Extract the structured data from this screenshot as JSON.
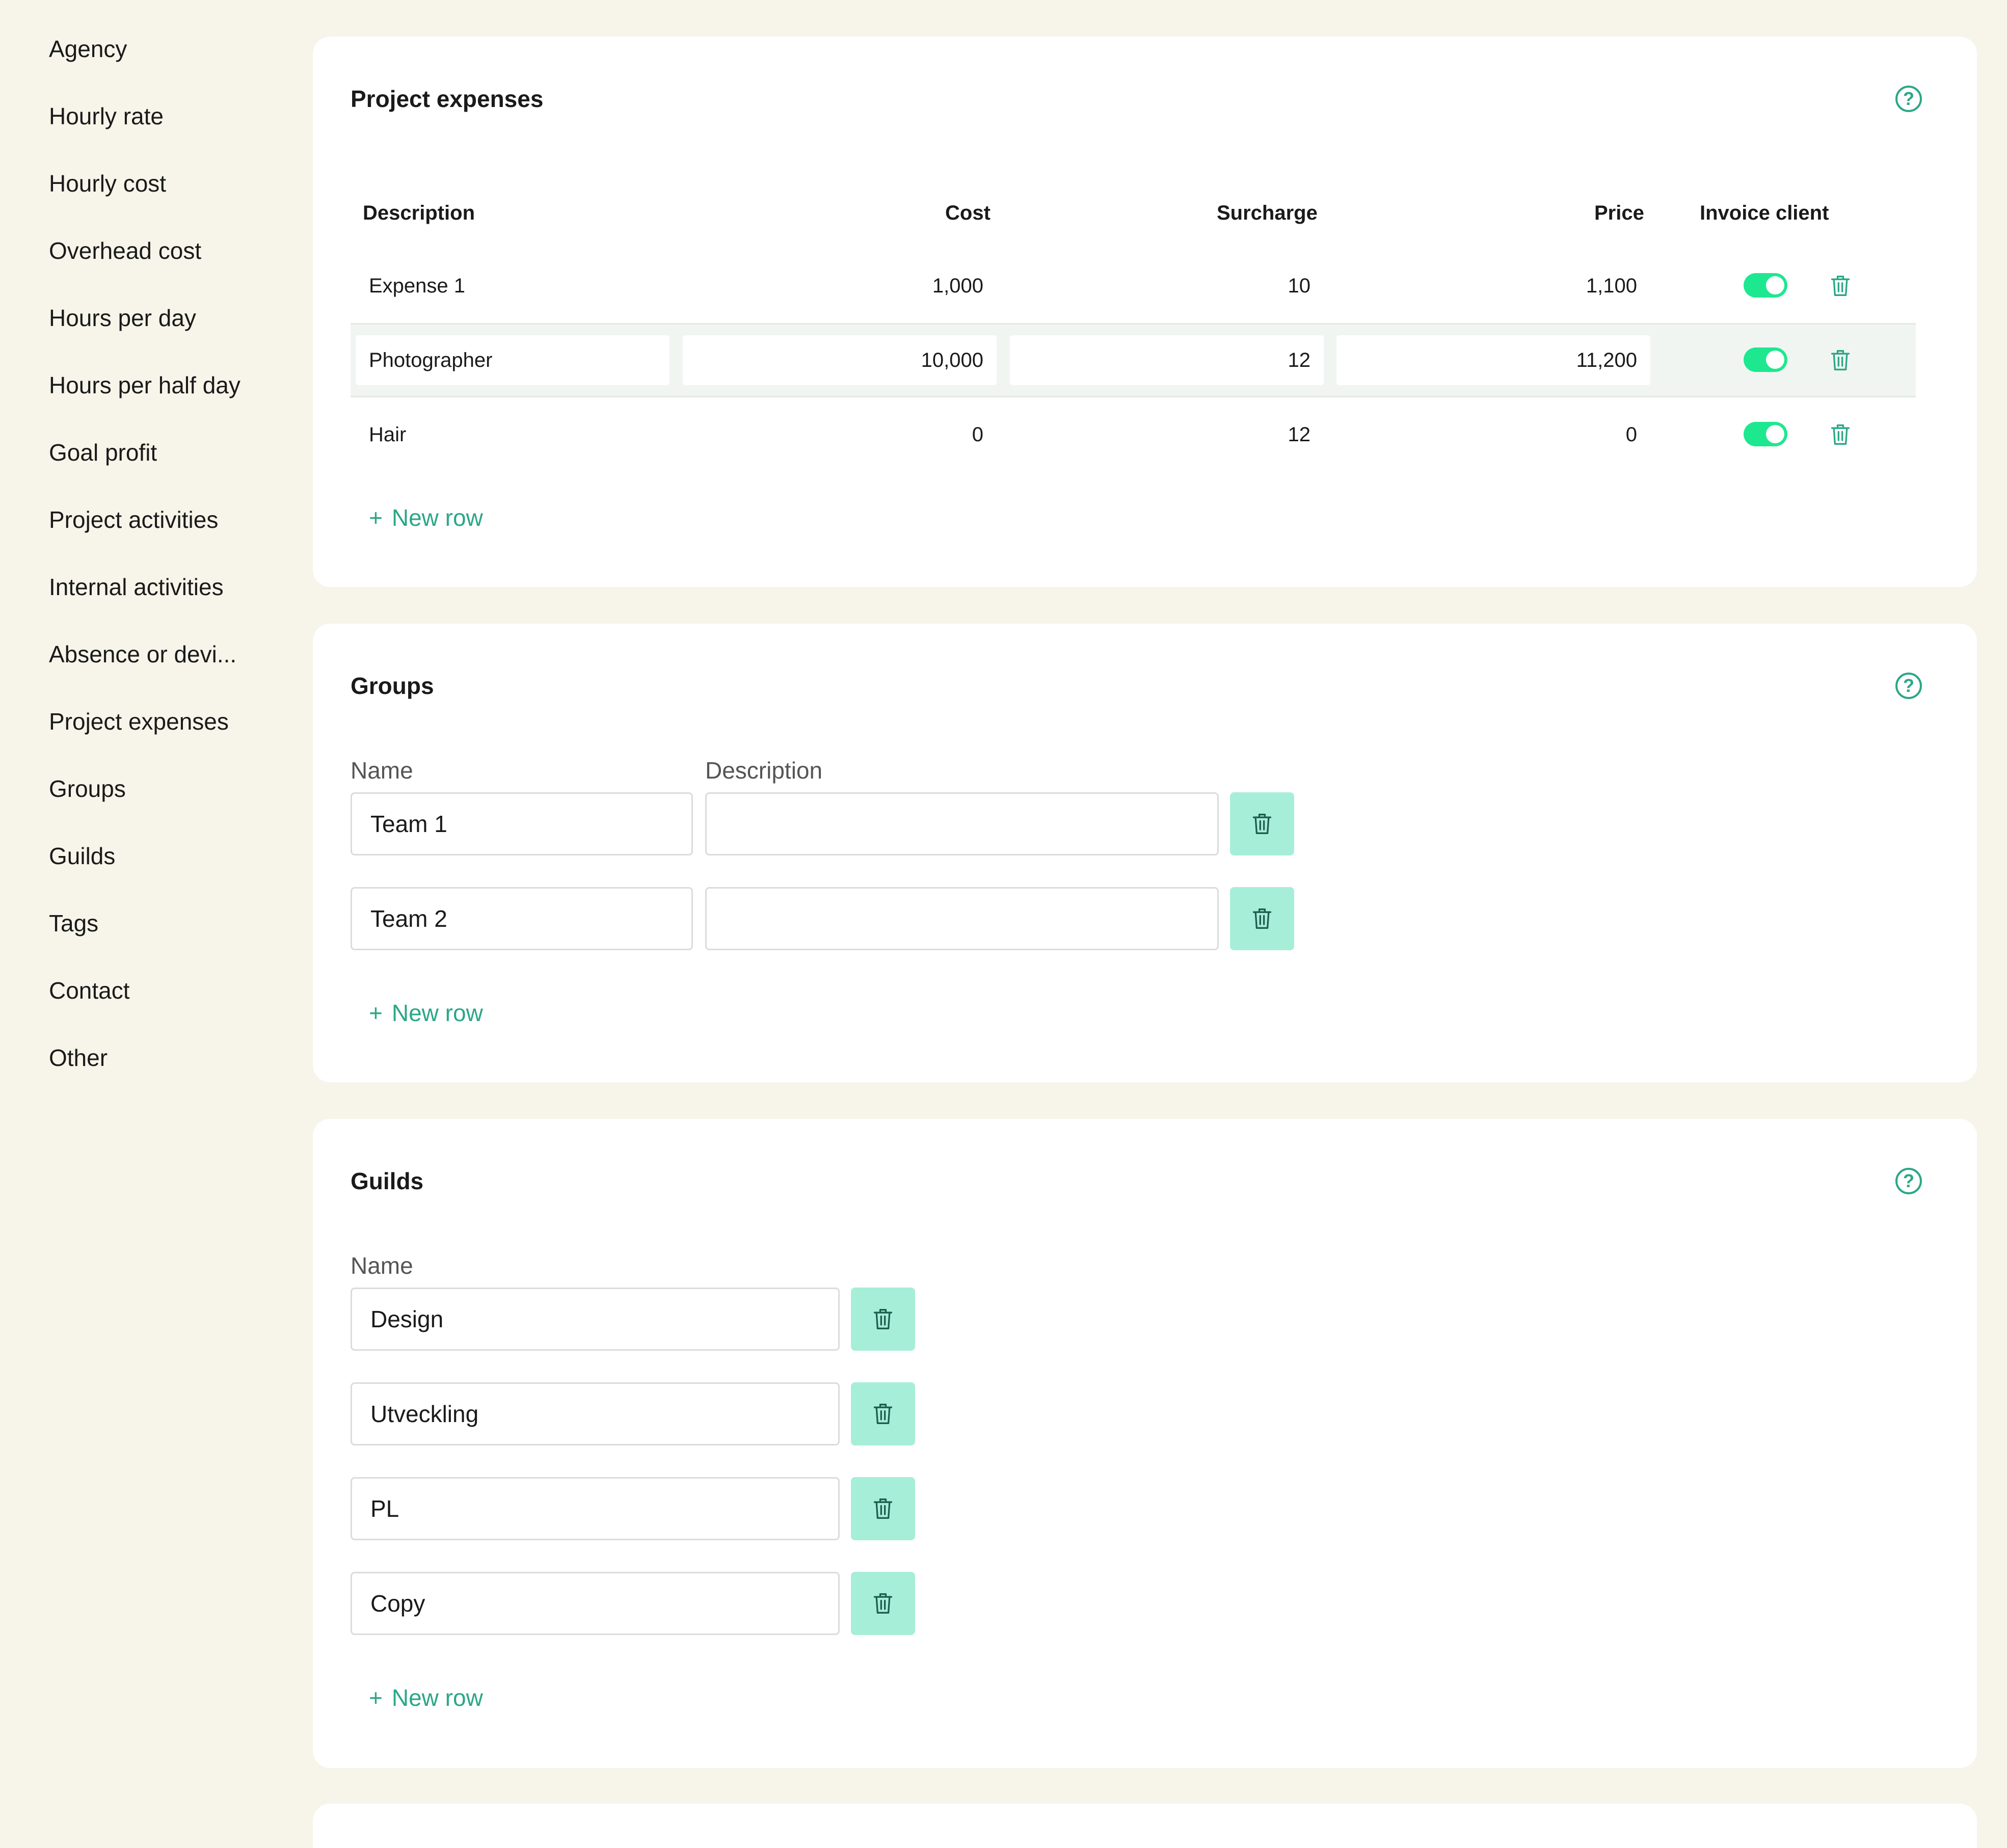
{
  "sidebar": {
    "items": [
      {
        "label": "Agency"
      },
      {
        "label": "Hourly rate"
      },
      {
        "label": "Hourly cost"
      },
      {
        "label": "Overhead cost"
      },
      {
        "label": "Hours per day"
      },
      {
        "label": "Hours per half day"
      },
      {
        "label": "Goal profit"
      },
      {
        "label": "Project activities"
      },
      {
        "label": "Internal activities"
      },
      {
        "label": "Absence or devi..."
      },
      {
        "label": "Project expenses"
      },
      {
        "label": "Groups"
      },
      {
        "label": "Guilds"
      },
      {
        "label": "Tags"
      },
      {
        "label": "Contact"
      },
      {
        "label": "Other"
      }
    ]
  },
  "expenses": {
    "title": "Project expenses",
    "help_icon": "question-circle-icon",
    "columns": {
      "description": "Description",
      "cost": "Cost",
      "surcharge": "Surcharge",
      "price": "Price",
      "invoice": "Invoice client"
    },
    "rows": [
      {
        "description": "Expense 1",
        "cost": "1,000",
        "surcharge": "10",
        "price": "1,100",
        "invoice_client": true
      },
      {
        "description": "Photographer",
        "cost": "10,000",
        "surcharge": "12",
        "price": "11,200",
        "invoice_client": true
      },
      {
        "description": "Hair",
        "cost": "0",
        "surcharge": "12",
        "price": "0",
        "invoice_client": true
      }
    ],
    "new_row": "New row"
  },
  "groups": {
    "title": "Groups",
    "name_label": "Name",
    "description_label": "Description",
    "rows": [
      {
        "name": "Team 1",
        "description": ""
      },
      {
        "name": "Team 2",
        "description": ""
      }
    ],
    "new_row": "New row"
  },
  "guilds": {
    "title": "Guilds",
    "name_label": "Name",
    "rows": [
      {
        "name": "Design"
      },
      {
        "name": "Utveckling"
      },
      {
        "name": "PL"
      },
      {
        "name": "Copy"
      }
    ],
    "new_row": "New row"
  },
  "colors": {
    "accent": "#2aa786",
    "toggle_on": "#1ee88f",
    "trash_button_bg": "#a7eed8",
    "page_bg": "#f7f5ea"
  }
}
